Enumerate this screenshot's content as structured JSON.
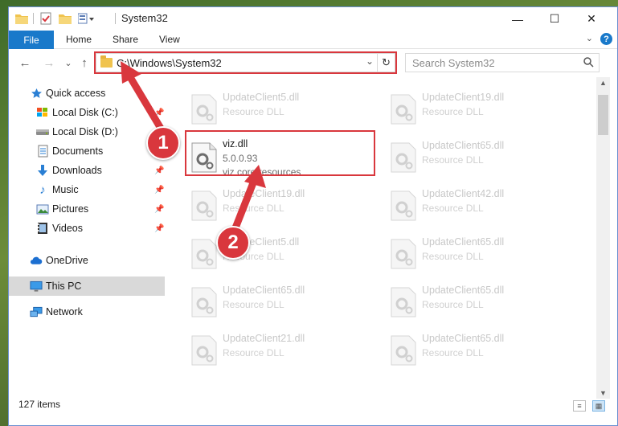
{
  "window": {
    "title": "System32"
  },
  "titlebar": {
    "quick_access_icons": [
      "folder-icon",
      "properties-checkmark-icon",
      "new-folder-icon",
      "customize-quick-access-icon"
    ],
    "buttons": {
      "minimize": "—",
      "maximize": "☐",
      "close": "✕"
    }
  },
  "ribbon": {
    "file_label": "File",
    "tabs": [
      "Home",
      "Share",
      "View"
    ],
    "help_label": "?"
  },
  "navigation": {
    "back_glyph": "←",
    "forward_glyph": "→",
    "recent_glyph": "⌄",
    "up_glyph": "↑",
    "address": "C:\\Windows\\System32",
    "search_placeholder": "Search System32"
  },
  "sidebar": {
    "items": [
      {
        "label": "Quick access",
        "icon": "star-icon",
        "pinned": false
      },
      {
        "label": "Local Disk (C:)",
        "icon": "drive-icon",
        "pinned": true
      },
      {
        "label": "Local Disk (D:)",
        "icon": "drive-icon",
        "pinned": true
      },
      {
        "label": "Documents",
        "icon": "documents-icon",
        "pinned": true
      },
      {
        "label": "Downloads",
        "icon": "download-icon",
        "pinned": true
      },
      {
        "label": "Music",
        "icon": "music-icon",
        "pinned": true
      },
      {
        "label": "Pictures",
        "icon": "pictures-icon",
        "pinned": true
      },
      {
        "label": "Videos",
        "icon": "videos-icon",
        "pinned": true
      },
      {
        "label": "OneDrive",
        "icon": "cloud-icon",
        "pinned": false
      },
      {
        "label": "This PC",
        "icon": "computer-icon",
        "pinned": false,
        "selected": true
      },
      {
        "label": "Network",
        "icon": "network-icon",
        "pinned": false
      }
    ]
  },
  "files": {
    "left_column": [
      {
        "name": "UpdateClient5.dll",
        "desc": "Resource DLL"
      },
      {
        "name": "viz.dll",
        "version": "5.0.0.93",
        "desc": "viz core resources",
        "highlighted": true
      },
      {
        "name": "UpdateClient19.dll",
        "desc": "Resource DLL"
      },
      {
        "name": "UpdateClient5.dll",
        "desc": "Resource DLL"
      },
      {
        "name": "UpdateClient65.dll",
        "desc": "Resource DLL"
      },
      {
        "name": "UpdateClient21.dll",
        "desc": "Resource DLL"
      }
    ],
    "right_column": [
      {
        "name": "UpdateClient19.dll",
        "desc": "Resource DLL"
      },
      {
        "name": "UpdateClient65.dll",
        "desc": "Resource DLL"
      },
      {
        "name": "UpdateClient42.dll",
        "desc": "Resource DLL"
      },
      {
        "name": "UpdateClient65.dll",
        "desc": "Resource DLL"
      },
      {
        "name": "UpdateClient65.dll",
        "desc": "Resource DLL"
      },
      {
        "name": "UpdateClient65.dll",
        "desc": "Resource DLL"
      }
    ]
  },
  "status": {
    "item_count": "127 items"
  },
  "annotations": {
    "step1": "1",
    "step2": "2",
    "color": "#d9373d"
  }
}
